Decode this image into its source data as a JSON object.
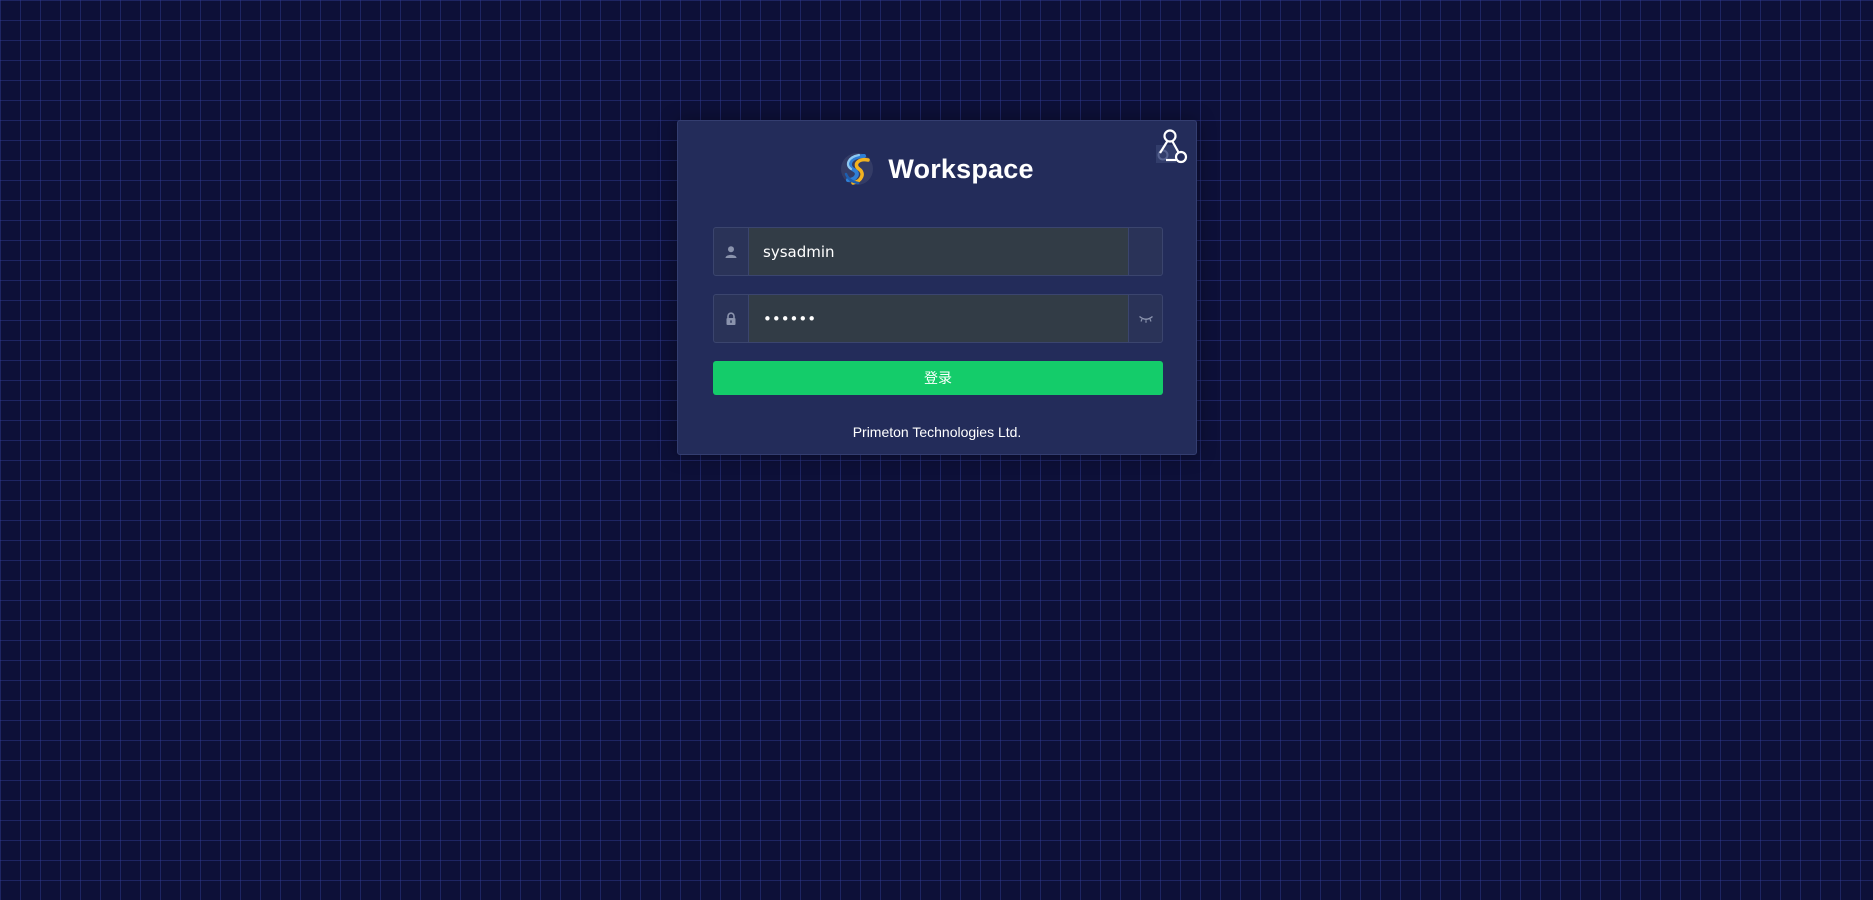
{
  "header": {
    "title": "Workspace"
  },
  "icons": {
    "corner_switch": "qr-switch-icon",
    "logo": "brand-logo-icon",
    "user": "user-icon",
    "lock": "lock-icon",
    "eye": "eye-closed-icon"
  },
  "form": {
    "username": {
      "value": "sysadmin",
      "placeholder": ""
    },
    "password": {
      "value": "••••••",
      "placeholder": ""
    },
    "submit_label": "登录"
  },
  "footer": {
    "text": "Primeton Technologies Ltd."
  },
  "colors": {
    "background": "#0d1038",
    "grid_line": "#343e96",
    "card": "#232c5a",
    "input": "#323c46",
    "button": "#14cc6a",
    "text": "#ffffff",
    "logo_blue": "#2f7fd6",
    "logo_gold": "#f2b320"
  }
}
